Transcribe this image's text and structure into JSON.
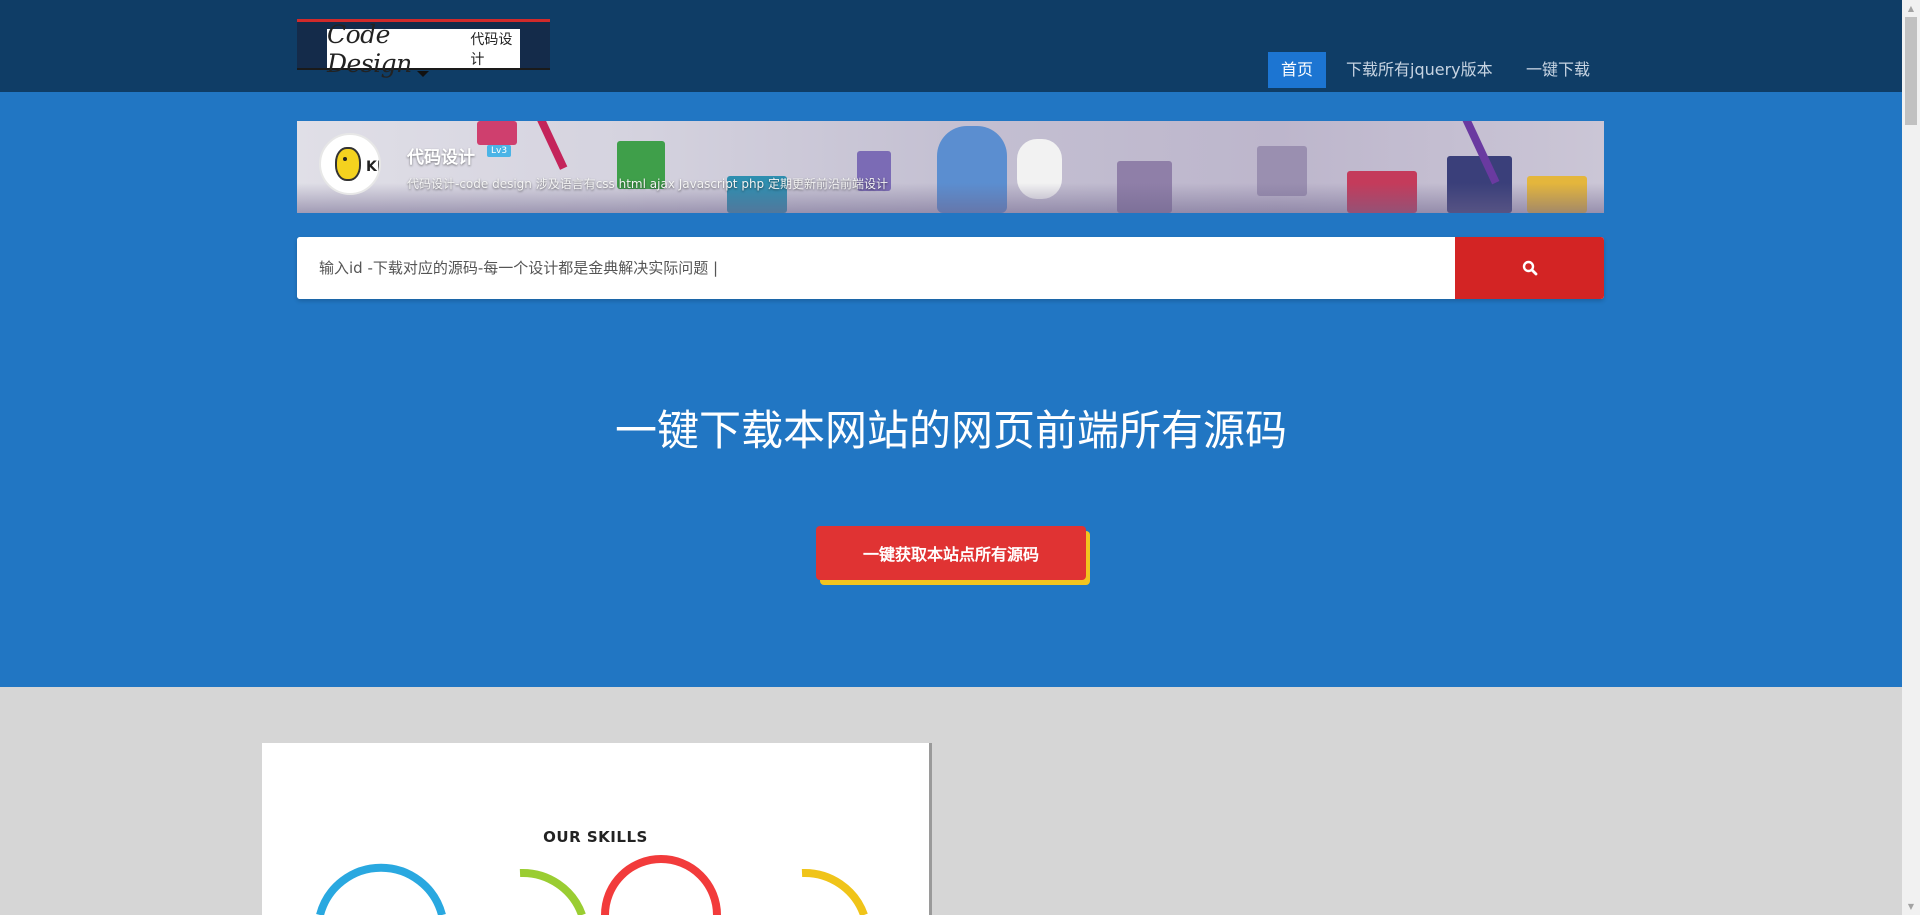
{
  "brand": {
    "logo_script": "Code Design",
    "logo_cn": "代码设计"
  },
  "nav": {
    "items": [
      {
        "label": "首页",
        "active": true
      },
      {
        "label": "下载所有jquery版本",
        "active": false
      },
      {
        "label": "一键下载",
        "active": false
      }
    ]
  },
  "banner": {
    "name": "代码设计",
    "level": "Lv3",
    "description": "代码设计-code design 涉及语言有css html ajax  Javascript php 定期更新前沿前端设计"
  },
  "search": {
    "placeholder": "输入id -下载对应的源码-每一个设计都是金典解决实际问题 |",
    "button_icon": "search-icon"
  },
  "hero": {
    "headline": "一键下载本网站的网页前端所有源码",
    "cta_label": "一键获取本站点所有源码"
  },
  "preview": {
    "title": "OUR SKILLS"
  },
  "colors": {
    "topbar": "#0f3d66",
    "hero": "#2176c3",
    "nav_active": "#1c75d2",
    "search_button": "#d32424",
    "cta": "#e03333",
    "cta_shadow": "#f2c41f",
    "skill_arcs": [
      "#29a8e0",
      "#9acd32",
      "#f23b3b",
      "#f0c419"
    ]
  }
}
